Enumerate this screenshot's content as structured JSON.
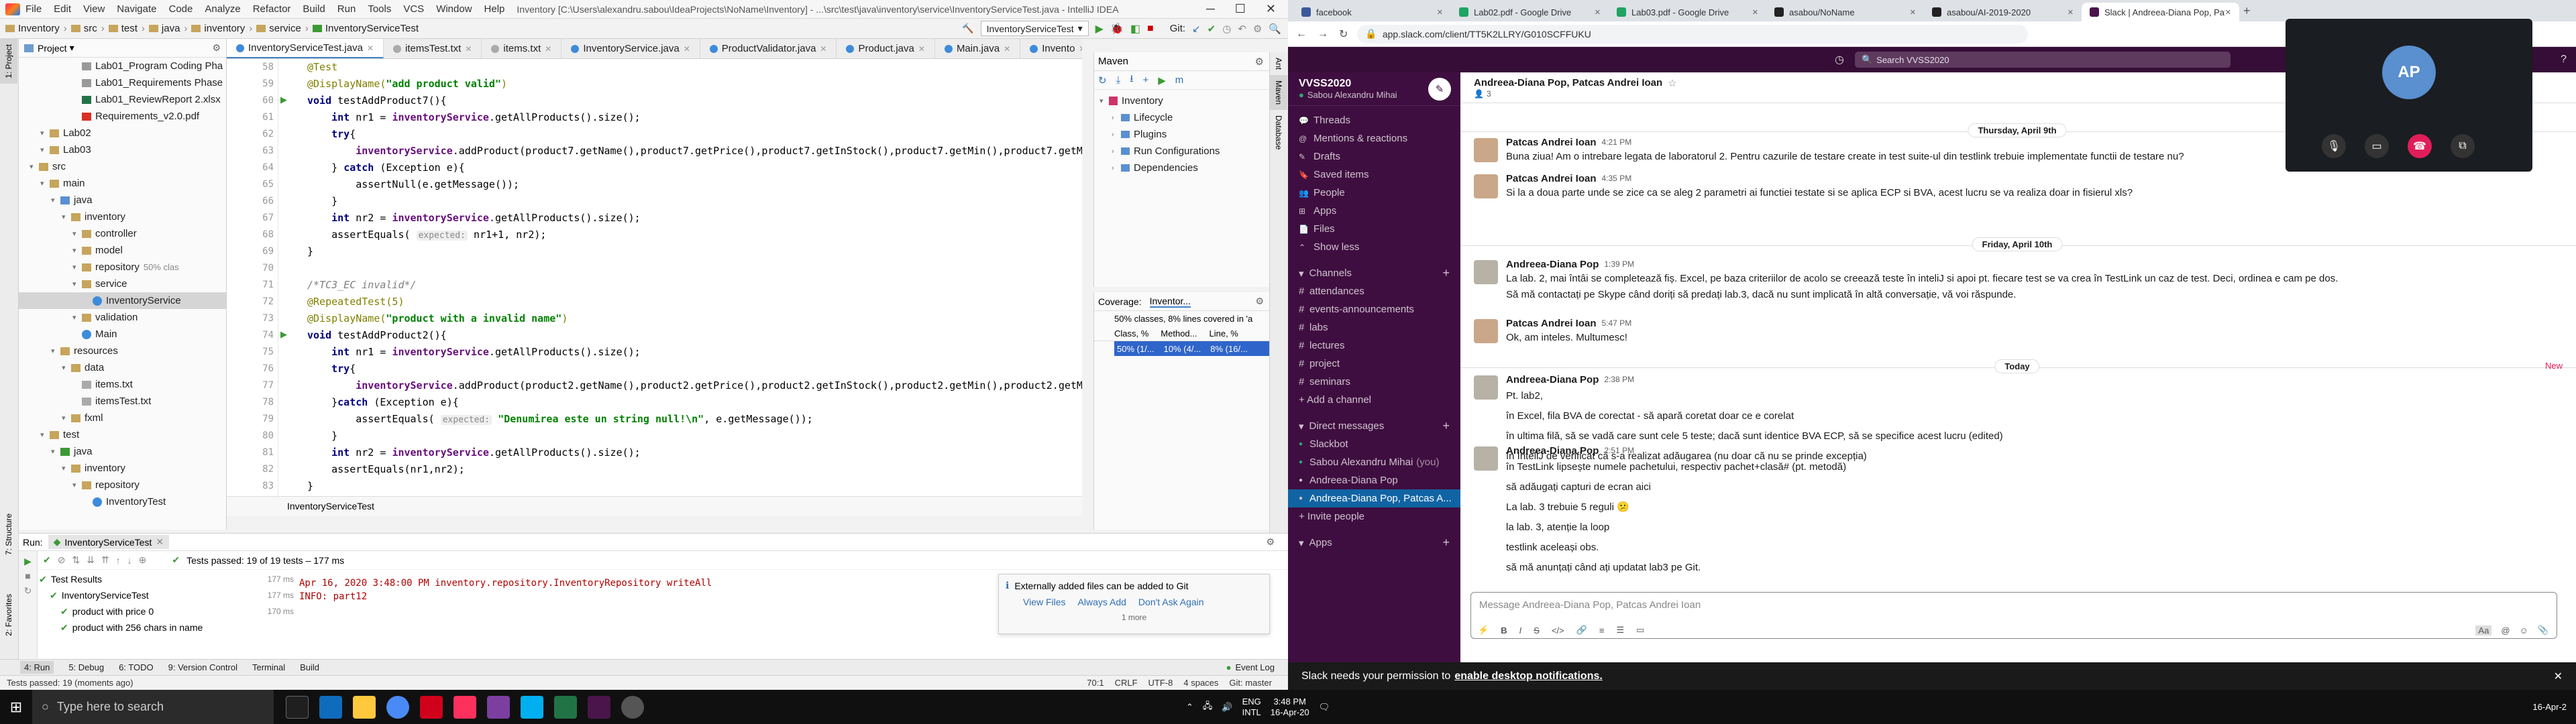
{
  "ij": {
    "project_name": "Inventory",
    "menu": [
      "File",
      "Edit",
      "View",
      "Navigate",
      "Code",
      "Analyze",
      "Refactor",
      "Build",
      "Run",
      "Tools",
      "VCS",
      "Window",
      "Help"
    ],
    "window_title": "Inventory [C:\\Users\\alexandru.sabou\\IdeaProjects\\NoName\\Inventory] - ...\\src\\test\\java\\inventory\\service\\InventoryServiceTest.java - IntelliJ IDEA",
    "breadcrumbs": [
      "Inventory",
      "src",
      "test",
      "java",
      "inventory",
      "service",
      "InventoryServiceTest"
    ],
    "run_config": "InventoryServiceTest",
    "git_label": "Git:",
    "project_panel_title": "Project",
    "tree": [
      {
        "label": "Lab01_Program Coding Pha",
        "indent": 5,
        "icon": "file"
      },
      {
        "label": "Lab01_Requirements Phase",
        "indent": 5,
        "icon": "file"
      },
      {
        "label": "Lab01_ReviewReport 2.xlsx",
        "indent": 5,
        "icon": "xls"
      },
      {
        "label": "Requirements_v2.0.pdf",
        "indent": 5,
        "icon": "pdf"
      },
      {
        "label": "Lab02",
        "indent": 2,
        "icon": "folder"
      },
      {
        "label": "Lab03",
        "indent": 2,
        "icon": "folder"
      },
      {
        "label": "src",
        "indent": 1,
        "icon": "folder"
      },
      {
        "label": "main",
        "indent": 2,
        "icon": "folder"
      },
      {
        "label": "java",
        "indent": 3,
        "icon": "folder-blue"
      },
      {
        "label": "inventory",
        "indent": 4,
        "icon": "folder"
      },
      {
        "label": "controller",
        "indent": 5,
        "icon": "folder"
      },
      {
        "label": "model",
        "indent": 5,
        "icon": "folder"
      },
      {
        "label": "repository",
        "indent": 5,
        "icon": "folder",
        "suffix": "50% clas"
      },
      {
        "label": "service",
        "indent": 5,
        "icon": "folder"
      },
      {
        "label": "InventoryService",
        "indent": 6,
        "icon": "class",
        "selected": true
      },
      {
        "label": "validation",
        "indent": 5,
        "icon": "folder"
      },
      {
        "label": "Main",
        "indent": 5,
        "icon": "class"
      },
      {
        "label": "resources",
        "indent": 3,
        "icon": "folder"
      },
      {
        "label": "data",
        "indent": 4,
        "icon": "folder"
      },
      {
        "label": "items.txt",
        "indent": 5,
        "icon": "txt"
      },
      {
        "label": "itemsTest.txt",
        "indent": 5,
        "icon": "txt"
      },
      {
        "label": "fxml",
        "indent": 4,
        "icon": "folder"
      },
      {
        "label": "test",
        "indent": 2,
        "icon": "folder"
      },
      {
        "label": "java",
        "indent": 3,
        "icon": "folder-green"
      },
      {
        "label": "inventory",
        "indent": 4,
        "icon": "folder"
      },
      {
        "label": "repository",
        "indent": 5,
        "icon": "folder"
      },
      {
        "label": "InventoryTest",
        "indent": 6,
        "icon": "class"
      }
    ],
    "tabs": [
      "InventoryServiceTest.java",
      "itemsTest.txt",
      "items.txt",
      "InventoryService.java",
      "ProductValidator.java",
      "Product.java",
      "Main.java",
      "Invento"
    ],
    "line_numbers": [
      "58",
      "59",
      "60",
      "61",
      "62",
      "63",
      "64",
      "65",
      "66",
      "67",
      "68",
      "69",
      "70",
      "71",
      "72",
      "73",
      "74",
      "75",
      "76",
      "77",
      "78",
      "79",
      "80",
      "81",
      "82",
      "83"
    ],
    "code_lines": [
      [
        {
          "t": "@Test",
          "c": "ann"
        }
      ],
      [
        {
          "t": "@DisplayName(",
          "c": "ann"
        },
        {
          "t": "\"add product valid\"",
          "c": "str"
        },
        {
          "t": ")",
          "c": "ann"
        }
      ],
      [
        {
          "t": "void ",
          "c": "kw"
        },
        {
          "t": "testAddProduct7(){",
          "c": ""
        }
      ],
      [
        {
          "t": "    int ",
          "c": "kw"
        },
        {
          "t": "nr1 = ",
          "c": ""
        },
        {
          "t": "inventoryService",
          "c": "fld"
        },
        {
          "t": ".getAllProducts().size();",
          "c": ""
        }
      ],
      [
        {
          "t": "    try",
          "c": "kw"
        },
        {
          "t": "{",
          "c": ""
        }
      ],
      [
        {
          "t": "        ",
          "c": ""
        },
        {
          "t": "inventoryService",
          "c": "fld"
        },
        {
          "t": ".addProduct(product7.getName(),product7.getPrice(),product7.getInStock(),product7.getMin(),product7.getMax",
          "c": ""
        }
      ],
      [
        {
          "t": "    } ",
          "c": ""
        },
        {
          "t": "catch ",
          "c": "kw"
        },
        {
          "t": "(Exception e){",
          "c": ""
        }
      ],
      [
        {
          "t": "        assertNull(e.getMessage());",
          "c": ""
        }
      ],
      [
        {
          "t": "    }",
          "c": ""
        }
      ],
      [
        {
          "t": "    int ",
          "c": "kw"
        },
        {
          "t": "nr2 = ",
          "c": ""
        },
        {
          "t": "inventoryService",
          "c": "fld"
        },
        {
          "t": ".getAllProducts().size();",
          "c": ""
        }
      ],
      [
        {
          "t": "    assertEquals( ",
          "c": ""
        },
        {
          "t": "expected:",
          "c": "hint"
        },
        {
          "t": " nr1+1, nr2);",
          "c": ""
        }
      ],
      [
        {
          "t": "}",
          "c": ""
        }
      ],
      [
        {
          "t": "",
          "c": ""
        }
      ],
      [
        {
          "t": "/*TC3_EC invalid*/",
          "c": "cmt"
        }
      ],
      [
        {
          "t": "@RepeatedTest(5)",
          "c": "ann"
        }
      ],
      [
        {
          "t": "@DisplayName(",
          "c": "ann"
        },
        {
          "t": "\"product with a invalid name\"",
          "c": "str"
        },
        {
          "t": ")",
          "c": "ann"
        }
      ],
      [
        {
          "t": "void ",
          "c": "kw"
        },
        {
          "t": "testAddProduct2(){",
          "c": ""
        }
      ],
      [
        {
          "t": "    int ",
          "c": "kw"
        },
        {
          "t": "nr1 = ",
          "c": ""
        },
        {
          "t": "inventoryService",
          "c": "fld"
        },
        {
          "t": ".getAllProducts().size();",
          "c": ""
        }
      ],
      [
        {
          "t": "    try",
          "c": "kw"
        },
        {
          "t": "{",
          "c": ""
        }
      ],
      [
        {
          "t": "        ",
          "c": ""
        },
        {
          "t": "inventoryService",
          "c": "fld"
        },
        {
          "t": ".addProduct(product2.getName(),product2.getPrice(),product2.getInStock(),product2.getMin(),product2.getMax",
          "c": ""
        }
      ],
      [
        {
          "t": "    }",
          "c": ""
        },
        {
          "t": "catch ",
          "c": "kw"
        },
        {
          "t": "(Exception e){",
          "c": ""
        }
      ],
      [
        {
          "t": "        assertEquals( ",
          "c": ""
        },
        {
          "t": "expected:",
          "c": "hint"
        },
        {
          "t": " ",
          "c": ""
        },
        {
          "t": "\"Denumirea este un string null!\\n\"",
          "c": "str"
        },
        {
          "t": ", e.getMessage());",
          "c": ""
        }
      ],
      [
        {
          "t": "    }",
          "c": ""
        }
      ],
      [
        {
          "t": "    int ",
          "c": "kw"
        },
        {
          "t": "nr2 = ",
          "c": ""
        },
        {
          "t": "inventoryService",
          "c": "fld"
        },
        {
          "t": ".getAllProducts().size();",
          "c": ""
        }
      ],
      [
        {
          "t": "    assertEquals(nr1,nr2);",
          "c": ""
        }
      ],
      [
        {
          "t": "}",
          "c": ""
        }
      ]
    ],
    "editor_footer": "InventoryServiceTest",
    "maven": {
      "title": "Maven",
      "root": "Inventory",
      "items": [
        "Lifecycle",
        "Plugins",
        "Run Configurations",
        "Dependencies"
      ]
    },
    "coverage": {
      "title": "Coverage:",
      "config": "Inventor...",
      "summary": "50% classes, 8% lines covered in 'a",
      "headers": [
        "Class, %",
        "Method...",
        "Line, %"
      ],
      "row": [
        "50% (1/...",
        "10% (4/...",
        "8% (16/..."
      ]
    },
    "run": {
      "tab_label": "Run:",
      "config": "InventoryServiceTest",
      "status_text": "Tests passed: 19 of 19 tests – 177 ms",
      "results": [
        {
          "label": "Test Results",
          "time": "177 ms",
          "indent": 0
        },
        {
          "label": "InventoryServiceTest",
          "time": "177 ms",
          "indent": 1
        },
        {
          "label": "product with price 0",
          "time": "170 ms",
          "indent": 2
        },
        {
          "label": "product with 256 chars in name",
          "time": "",
          "indent": 2
        }
      ],
      "log_lines": [
        "Apr 16, 2020 3:48:00 PM inventory.repository.InventoryRepository writeAll",
        "INFO: part12"
      ],
      "notification": {
        "text": "Externally added files can be added to Git",
        "actions": [
          "View Files",
          "Always Add",
          "Don't Ask Again"
        ],
        "more": "1 more"
      }
    },
    "bottom_tabs": [
      "4: Run",
      "5: Debug",
      "6: TODO",
      "9: Version Control",
      "Terminal",
      "Build"
    ],
    "event_log": "Event Log",
    "status_left": "Tests passed: 19 (moments ago)",
    "status_right": [
      "70:1",
      "CRLF",
      "UTF-8",
      "4 spaces",
      "Git: master"
    ]
  },
  "taskbar": {
    "search_placeholder": "Type here to search",
    "time": "3:48 PM",
    "date": "16-Apr-20",
    "lang": "ENG",
    "lang2": "INTL",
    "right_date": "16-Apr-2"
  },
  "chrome": {
    "tabs": [
      {
        "title": "facebook",
        "active": false
      },
      {
        "title": "Lab02.pdf - Google Drive",
        "active": false
      },
      {
        "title": "Lab03.pdf - Google Drive",
        "active": false
      },
      {
        "title": "asabou/NoName",
        "active": false
      },
      {
        "title": "asabou/AI-2019-2020",
        "active": false
      },
      {
        "title": "Slack | Andreea-Diana Pop, Patca...",
        "active": true
      }
    ],
    "url": "app.slack.com/client/TT5K2LLRY/G010SCFFUKU"
  },
  "slack": {
    "search": "Search VVSS2020",
    "workspace": "VVSS2020",
    "user": "Sabou Alexandru Mihai",
    "nav": [
      "Threads",
      "Mentions & reactions",
      "Drafts",
      "Saved items",
      "People",
      "Apps",
      "Files",
      "Show less"
    ],
    "channels_header": "Channels",
    "channels": [
      "attendances",
      "events-announcements",
      "labs",
      "lectures",
      "project",
      "seminars"
    ],
    "add_channel": "+ Add a channel",
    "dm_header": "Direct messages",
    "dms": [
      {
        "name": "Slackbot",
        "selected": false
      },
      {
        "name": "Sabou Alexandru Mihai",
        "suffix": "(you)",
        "selected": false
      },
      {
        "name": "Andreea-Diana Pop",
        "selected": false
      },
      {
        "name": "Andreea-Diana Pop, Patcas A...",
        "selected": true
      }
    ],
    "invite": "+ Invite people",
    "apps_header": "Apps",
    "conv_title": "Andreea-Diana Pop, Patcas Andrei Ioan",
    "member_count": "3",
    "days": [
      "Thursday, April 9th",
      "Friday, April 10th",
      "Today"
    ],
    "new_label": "New",
    "messages": [
      {
        "author": "Patcas Andrei Ioan",
        "time": "4:21 PM",
        "lines": [
          "Buna ziua! Am o intrebare legata de laboratorul 2. Pentru  cazurile de testare create in test suite-ul din testlink trebuie implementate functii de testare nu?"
        ]
      },
      {
        "author": "Patcas Andrei Ioan",
        "time": "4:35 PM",
        "lines": [
          "Si la a doua parte unde se zice ca se aleg 2 parametri ai functiei testate si se aplica ECP si BVA, acest lucru se va realiza doar in fisierul xls?"
        ]
      },
      {
        "author": "Andreea-Diana Pop",
        "time": "1:39 PM",
        "lines": [
          "La lab. 2, mai întâi se completează fiș. Excel, pe baza criteriilor de acolo se creează teste în inteliJ si apoi pt. fiecare test se va crea în TestLink un caz de test. Deci, ordinea e cam pe dos.",
          "Să mă contactați pe Skype când doriți să predați lab.3, dacă nu sunt implicată în altă conversație, vă voi răspunde."
        ]
      },
      {
        "author": "Patcas Andrei Ioan",
        "time": "5:47 PM",
        "lines": [
          "Ok, am inteles. Multumesc!"
        ]
      },
      {
        "author": "Andreea-Diana Pop",
        "time": "2:38 PM",
        "lines": [
          "Pt. lab2,",
          "în Excel, fila BVA de corectat - să apară coretat doar ce e corelat",
          "în ultima filă, să se vadă care sunt cele 5 teste; dacă sunt identice BVA ECP, să se specifice acest lucru (edited)",
          "în InteliJ de verificat că s-a realizat adăugarea (nu doar că nu se prinde excepția)"
        ]
      },
      {
        "author": "Andreea-Diana Pop",
        "time": "2:51 PM",
        "lines": [
          "în TestLink lipsește numele pachetului, respectiv pachet+clasă# (pt. metodă)",
          "să adăugați capturi de ecran aici",
          "La lab. 3 trebuie 5 reguli 😕",
          "la lab. 3, atenție la loop",
          "testlink aceleași obs.",
          "să mă anunțați când ați updatat lab3 pe Git."
        ]
      }
    ],
    "composer_placeholder": "Message Andreea-Diana Pop, Patcas Andrei Ioan",
    "permission_text": "Slack needs your permission to",
    "permission_link": "enable desktop notifications.",
    "call_initials": "AP"
  }
}
